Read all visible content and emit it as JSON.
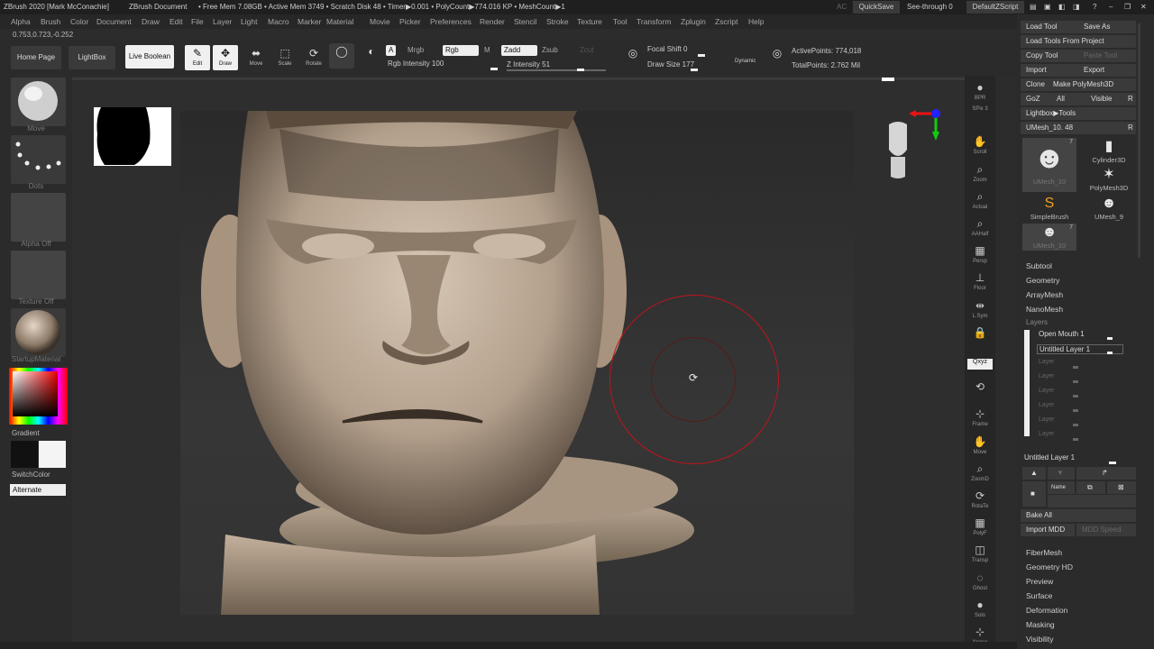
{
  "titlebar": {
    "app": "ZBrush 2020 [Mark McConachie]",
    "doc": "ZBrush Document",
    "stats": "• Free Mem 7.08GB • Active Mem 3749 • Scratch Disk 48 • Timer▶0.001 • PolyCount▶774.016 KP • MeshCount▶1",
    "ac": "AC",
    "quicksave": "QuickSave",
    "seethrough": "See-through  0",
    "script": "DefaultZScript"
  },
  "menu": [
    "Alpha",
    "Brush",
    "Color",
    "Document",
    "Draw",
    "Edit",
    "File",
    "Layer",
    "Light",
    "Macro",
    "Marker",
    "Material",
    "Movie",
    "Picker",
    "Preferences",
    "Render",
    "Stencil",
    "Stroke",
    "Texture",
    "Tool",
    "Transform",
    "Zplugin",
    "Zscript",
    "Help"
  ],
  "coords": "0.753,0.723,-0.252",
  "toolbar": {
    "home": "Home Page",
    "lightbox": "LightBox",
    "liveboolean": "Live Boolean",
    "tools": [
      {
        "label": "Edit",
        "glyph": "✎"
      },
      {
        "label": "Draw",
        "glyph": "✥"
      },
      {
        "label": "Move",
        "glyph": "⬌"
      },
      {
        "label": "Scale",
        "glyph": "⬚"
      },
      {
        "label": "Rotate",
        "glyph": "⟳"
      }
    ],
    "a": "A",
    "mrgb": "Mrgb",
    "rgb": "Rgb",
    "m": "M",
    "zadd": "Zadd",
    "zsub": "Zsub",
    "zcut": "Zcut",
    "rgbintensity": "Rgb Intensity 100",
    "zintensity": "Z Intensity 51",
    "focalshift": "Focal Shift 0",
    "drawsize": "Draw Size 177",
    "dynamic": "Dynamic",
    "activepoints": "ActivePoints: 774,018",
    "totalpoints": "TotalPoints: 2.762 Mil"
  },
  "leftpanel": {
    "move": "Move",
    "dots": "Dots",
    "alphaoff": "Alpha Off",
    "textureoff": "Texture Off",
    "material": "StartupMaterial",
    "gradient": "Gradient",
    "switchcolor": "SwitchColor",
    "alternate": "Alternate"
  },
  "rightstrip": [
    {
      "label": "BPR",
      "glyph": "●"
    },
    {
      "label": "SPix 3",
      "glyph": ""
    },
    {
      "label": "Scroll",
      "glyph": "✋"
    },
    {
      "label": "Zoom",
      "glyph": "⌕"
    },
    {
      "label": "Actual",
      "glyph": "⌕"
    },
    {
      "label": "AAHalf",
      "glyph": "⌕"
    },
    {
      "label": "Persp",
      "glyph": "▦"
    },
    {
      "label": "Floor",
      "glyph": "⊥"
    },
    {
      "label": "L.Sym",
      "glyph": "⇹"
    },
    {
      "label": "",
      "glyph": "🔒"
    },
    {
      "label": "Qxyz",
      "glyph": ""
    },
    {
      "label": "",
      "glyph": "⟲"
    },
    {
      "label": "Frame",
      "glyph": "⊹"
    },
    {
      "label": "Move",
      "glyph": "✋"
    },
    {
      "label": "ZoomD",
      "glyph": "⌕"
    },
    {
      "label": "RotaTe",
      "glyph": "⟳"
    },
    {
      "label": "PolyF",
      "glyph": "▦"
    },
    {
      "label": "Transp",
      "glyph": "◫"
    },
    {
      "label": "Ghost",
      "glyph": "◌"
    },
    {
      "label": "Solo",
      "glyph": "●"
    },
    {
      "label": "Xpose",
      "glyph": "⊹"
    }
  ],
  "rightpanel": {
    "loadtool": "Load Tool",
    "saveas": "Save As",
    "loadfromproject": "Load Tools From Project",
    "copytool": "Copy Tool",
    "pastetool": "Paste Tool",
    "import": "Import",
    "export": "Export",
    "clone": "Clone",
    "makepoly": "Make PolyMesh3D",
    "goz": "GoZ",
    "all": "All",
    "visible": "Visible",
    "r": "R",
    "lightboxtools": "Lightbox▶Tools",
    "umesh": "UMesh_10. 48",
    "thumbs": [
      {
        "name": "UMesh_10",
        "count": "7"
      },
      {
        "name": "Cylinder3D"
      },
      {
        "name": "PolyMesh3D"
      },
      {
        "name": "SimpleBrush"
      },
      {
        "name": "UMesh_9"
      },
      {
        "name": "UMesh_10",
        "count": "7"
      }
    ],
    "menus1": [
      "Subtool",
      "Geometry",
      "ArrayMesh",
      "NanoMesh"
    ],
    "layers_header": "Layers",
    "layers": [
      "Open Mouth 1",
      "Untitled Layer 1",
      "Layer",
      "Layer",
      "Layer",
      "Layer",
      "Layer",
      "Layer"
    ],
    "current_layer": "Untitled Layer 1",
    "name_btn": "Name",
    "bakeall": "Bake All",
    "importmdd": "Import MDD",
    "mddspeed": "MDD Speed",
    "menus2": [
      "FiberMesh",
      "Geometry HD",
      "Preview",
      "Surface",
      "Deformation",
      "Masking",
      "Visibility"
    ]
  },
  "colors": {
    "accent_red": "#c8181e",
    "brush_circle": "#c0141b"
  }
}
